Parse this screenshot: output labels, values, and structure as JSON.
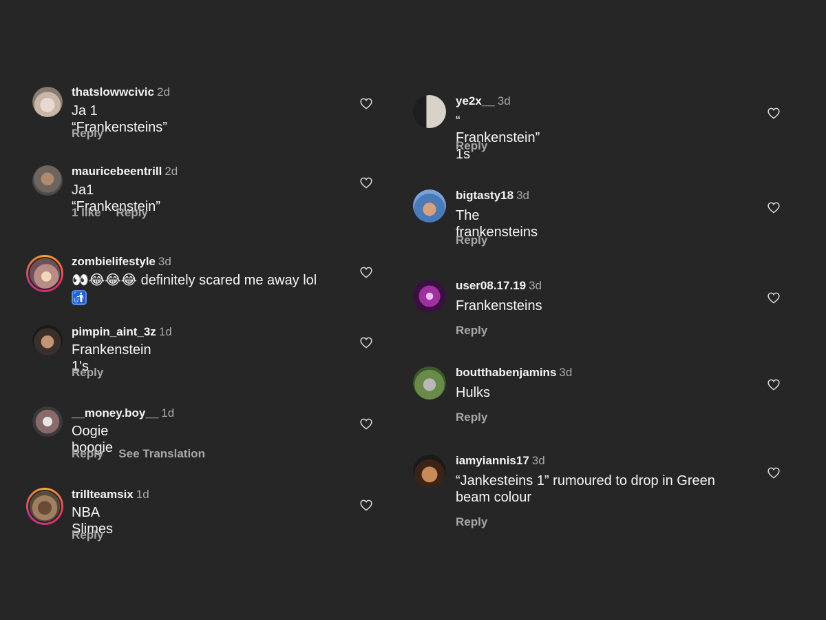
{
  "comments": [
    {
      "username": "thatslowwcivic",
      "time": "2d",
      "text": "Ja 1 “Frankensteins”",
      "reply": "Reply"
    },
    {
      "username": "mauricebeentrill",
      "time": "2d",
      "text": "Ja1 “Frankenstein”",
      "likes": "1 like",
      "reply": "Reply"
    },
    {
      "username": "zombielifestyle",
      "time": "3d",
      "text": "definitely scared me away lol",
      "emojis": "👀😂😂😂",
      "emoji2": "🚮"
    },
    {
      "username": "pimpin_aint_3z",
      "time": "1d",
      "text": "Frankenstein 1's",
      "reply": "Reply"
    },
    {
      "username": "__money.boy__",
      "time": "1d",
      "text": "Oogie boogie",
      "reply": "Reply",
      "translate": "See Translation"
    },
    {
      "username": "trillteamsix",
      "time": "1d",
      "text": "NBA Slimes",
      "reply": "Reply"
    },
    {
      "username": "ye2x__",
      "time": "3d",
      "text": "“ Frankenstein” 1s",
      "reply": "Reply"
    },
    {
      "username": "bigtasty18",
      "time": "3d",
      "text": "The frankensteins",
      "reply": "Reply"
    },
    {
      "username": "user08.17.19",
      "time": "3d",
      "text": "Frankensteins",
      "reply": "Reply"
    },
    {
      "username": "boutthabenjamins",
      "time": "3d",
      "text": "Hulks",
      "reply": "Reply"
    },
    {
      "username": "iamyiannis17",
      "time": "3d",
      "text": "“Jankesteins 1” rumoured to drop in Green beam colour",
      "reply": "Reply"
    }
  ],
  "colors": {
    "background": "#262626",
    "text": "#f5f5f5",
    "muted": "#a8a8a8"
  },
  "icons": {
    "like": "heart-outline-icon",
    "avatar": "user-avatar"
  }
}
